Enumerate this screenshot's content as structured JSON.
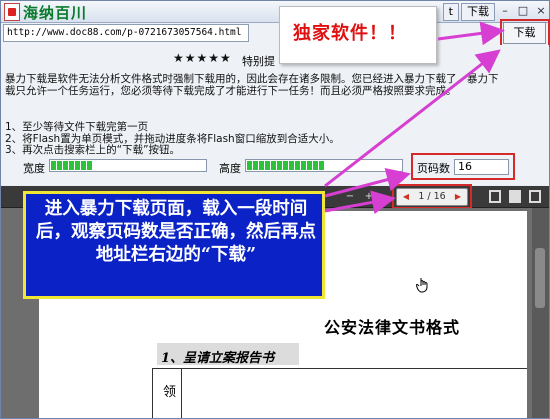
{
  "window": {
    "app_title": "海纳百川",
    "toolbar_partial": "t",
    "download_tab": "下载",
    "minimize": "–",
    "restore": "□",
    "close": "×"
  },
  "address": {
    "url": "http://www.doc88.com/p-0721673057564.html",
    "download_button": "下载"
  },
  "panel": {
    "stars": "★★★★★",
    "prompt_partial": "特别提",
    "note": "暴力下载是软件无法分析文件格式时强制下载用的，因此会存在诸多限制。您已经进入暴力下载了，暴力下载只允许一个任务运行，您必须等待下载完成了才能进行下一任务！而且必须严格按照要求完成。",
    "steps": [
      "1、至少等待文件下载完第一页",
      "2、将Flash置为单页模式，并拖动进度条将Flash窗口缩放到合适大小。",
      "3、再次点击搜索栏上的“下载”按钮。"
    ],
    "width_label": "宽度",
    "height_label": "高度",
    "width_progress": 0.26,
    "height_progress": 0.5,
    "pages_label": "页码数",
    "pages_value": "16"
  },
  "viewer": {
    "page_indicator": "1 / 16",
    "zoom_out": "−",
    "zoom_in": "+"
  },
  "document": {
    "title": "公安法律文书格式",
    "heading": "1、呈请立案报告书",
    "cell": "领"
  },
  "callouts": {
    "top": "独家软件！！",
    "main": "进入暴力下载页面，载入一段时间后，观察页码数是否正确，然后再点地址栏右边的“下载”"
  },
  "colors": {
    "callout_red": "#e01010",
    "callout_blue": "#0a22c6",
    "callout_border": "#f2e634",
    "arrow_magenta": "#d63fd2",
    "highlight_red": "#d62a2a",
    "progress_green": "#2ec13c"
  }
}
